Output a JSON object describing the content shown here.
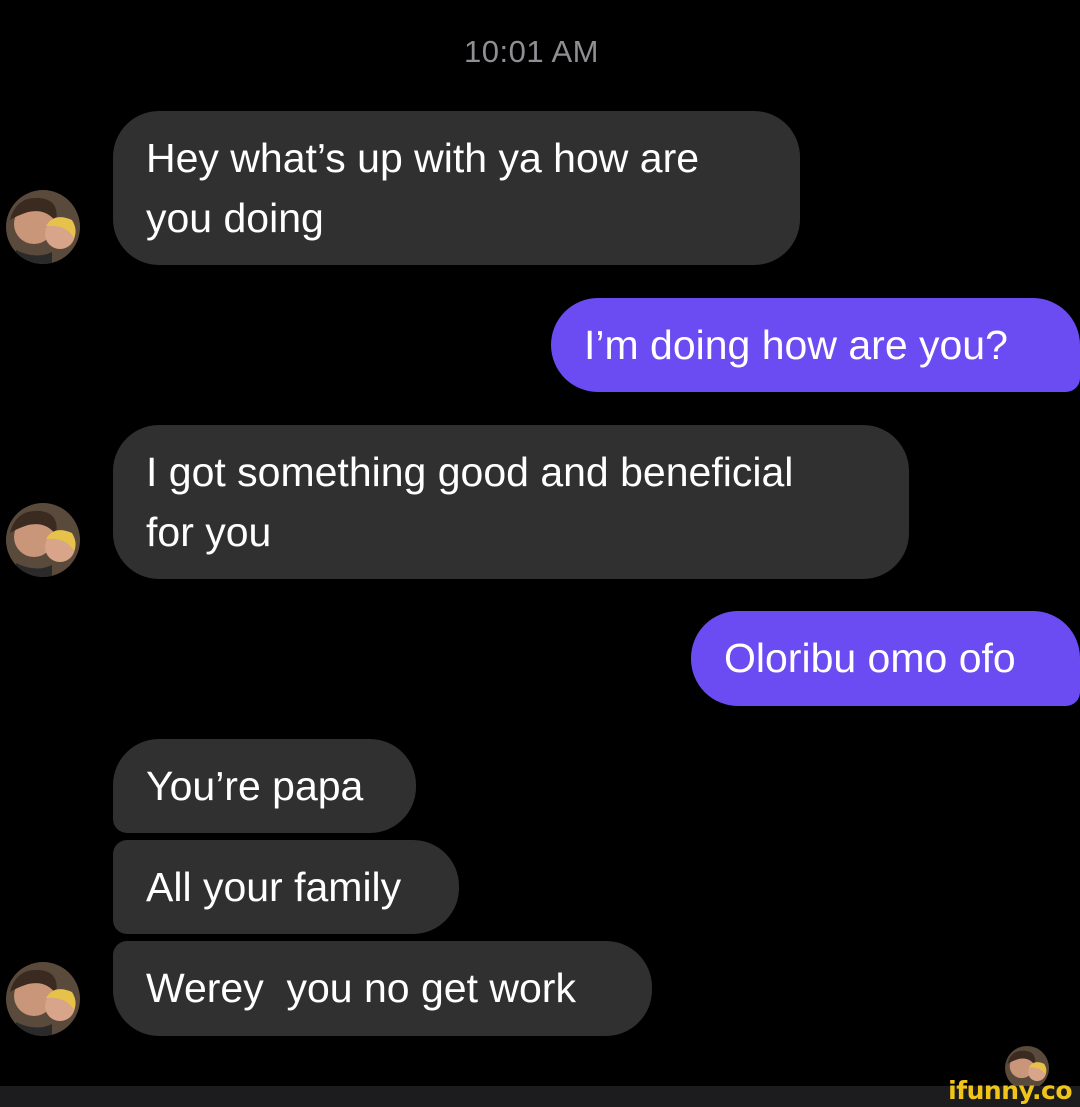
{
  "header": {
    "time": "10:01 AM"
  },
  "messages": [
    {
      "direction": "incoming",
      "text": "Hey what’s up with ya how are\nyou doing"
    },
    {
      "direction": "outgoing",
      "text": "I’m doing how are you?"
    },
    {
      "direction": "incoming",
      "text": "I got something good and beneficial\nfor you"
    },
    {
      "direction": "outgoing",
      "text": "Oloribu omo ofo"
    },
    {
      "direction": "incoming",
      "text": "You’re papa"
    },
    {
      "direction": "incoming",
      "text": "All your family"
    },
    {
      "direction": "incoming",
      "text": "Werey  you no get work"
    }
  ],
  "colors": {
    "background": "#000000",
    "incoming_bubble": "#303030",
    "outgoing_bubble": "#6a4cf2",
    "timestamp": "#8e8e93",
    "watermark": "#f0c419"
  },
  "icons": {
    "avatar": "contact-avatar-photo",
    "read_receipt": "seen-avatar-photo"
  },
  "watermark": {
    "text": "ifunny.co"
  }
}
